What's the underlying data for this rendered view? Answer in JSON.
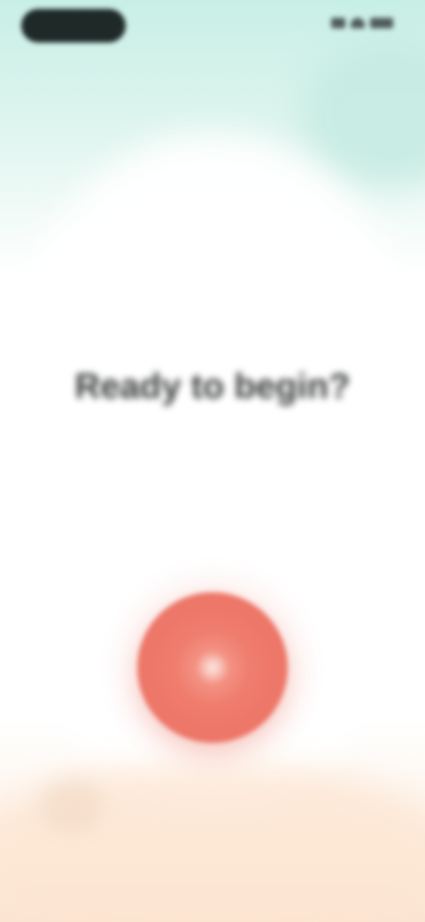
{
  "status_bar": {
    "time": "",
    "icons": [
      "signal-icon",
      "wifi-icon",
      "battery-icon"
    ]
  },
  "prompt": {
    "hint": "",
    "title": "Ready to begin?"
  },
  "record_button": {
    "icon": "mic-icon",
    "color": "#ea6f61"
  },
  "colors": {
    "top_tint": "#c8efe6",
    "bottom_tint": "#fbe4d2",
    "title_text": "#3a3d3c",
    "record_button": "#ea6f61"
  }
}
